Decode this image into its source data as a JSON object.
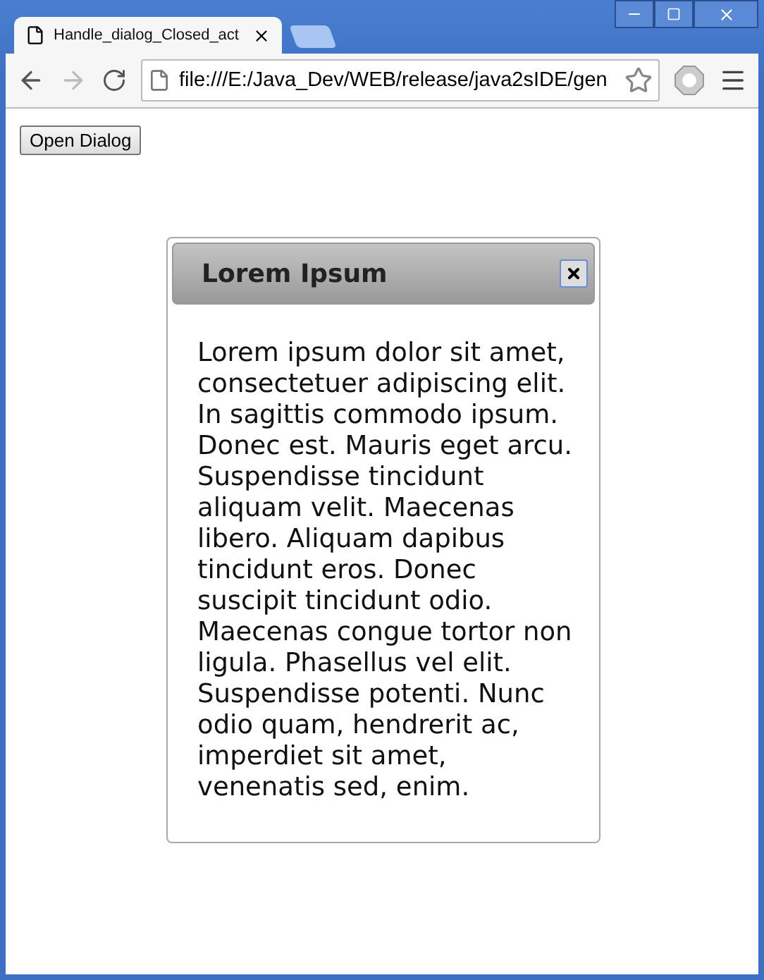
{
  "browser": {
    "tab_title": "Handle_dialog_Closed_act",
    "address": "file:///E:/Java_Dev/WEB/release/java2sIDE/gen"
  },
  "page": {
    "open_button": "Open Dialog"
  },
  "dialog": {
    "title": "Lorem Ipsum",
    "body": "Lorem ipsum dolor sit amet, consectetuer adipiscing elit. In sagittis commodo ipsum. Donec est. Mauris eget arcu. Suspendisse tincidunt aliquam velit. Maecenas libero. Aliquam dapibus tincidunt eros. Donec suscipit tincidunt odio. Maecenas congue tortor non ligula. Phasellus vel elit. Suspendisse potenti. Nunc odio quam, hendrerit ac, imperdiet sit amet, venenatis sed, enim."
  }
}
